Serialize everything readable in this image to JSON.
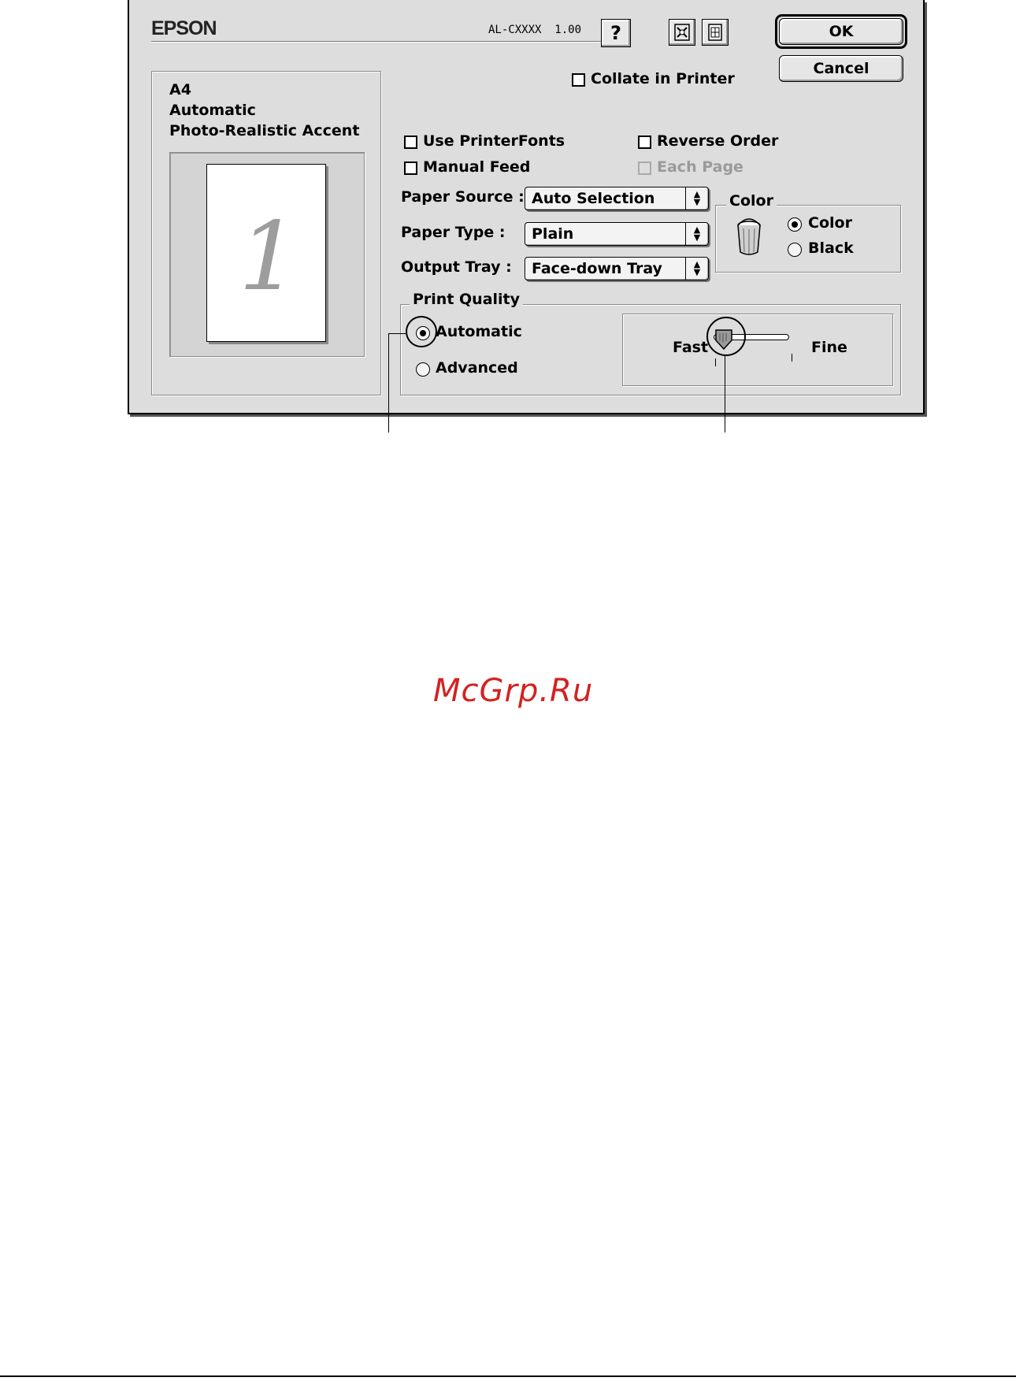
{
  "header": {
    "brand": "EPSON",
    "model_version": "AL-CXXXX  1.00",
    "help_icon": "question-mark-icon",
    "utility_icon": "printer-utility-icon",
    "layout_icon": "layout-icon"
  },
  "buttons": {
    "ok": "OK",
    "cancel": "Cancel"
  },
  "summary": {
    "paper_size": "A4",
    "mode": "Automatic",
    "setting": "Photo-Realistic Accent"
  },
  "preview": {
    "page_number": "1"
  },
  "options": {
    "collate": {
      "label": "Collate in Printer",
      "checked": false
    },
    "use_printer_fonts": {
      "label": "Use PrinterFonts",
      "checked": false
    },
    "reverse_order": {
      "label": "Reverse Order",
      "checked": false
    },
    "manual_feed": {
      "label": "Manual Feed",
      "checked": false
    },
    "each_page": {
      "label": "Each Page",
      "checked": false,
      "disabled": true
    }
  },
  "selects": {
    "paper_source": {
      "label": "Paper Source :",
      "value": "Auto Selection"
    },
    "paper_type": {
      "label": "Paper Type :",
      "value": "Plain"
    },
    "output_tray": {
      "label": "Output Tray :",
      "value": "Face-down Tray"
    }
  },
  "color": {
    "title": "Color",
    "icon": "paint-bucket-icon",
    "options": [
      {
        "label": "Color",
        "selected": true
      },
      {
        "label": "Black",
        "selected": false
      }
    ]
  },
  "print_quality": {
    "title": "Print Quality",
    "options": [
      {
        "label": "Automatic",
        "selected": true
      },
      {
        "label": "Advanced",
        "selected": false
      }
    ],
    "slider": {
      "left_label": "Fast",
      "right_label": "Fine",
      "level": 0
    }
  },
  "watermark": "McGrp.Ru"
}
